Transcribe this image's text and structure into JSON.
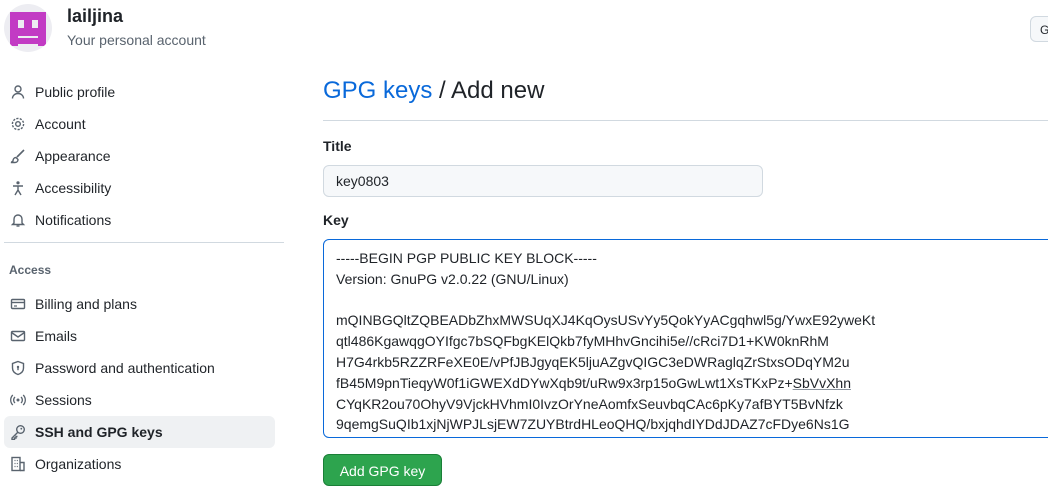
{
  "user": {
    "name": "lailjina",
    "subtitle": "Your personal account"
  },
  "corner_button": {
    "label": "G"
  },
  "nav": {
    "group1": [
      {
        "label": "Public profile",
        "icon": "person-icon"
      },
      {
        "label": "Account",
        "icon": "gear-icon"
      },
      {
        "label": "Appearance",
        "icon": "paintbrush-icon"
      },
      {
        "label": "Accessibility",
        "icon": "accessibility-icon"
      },
      {
        "label": "Notifications",
        "icon": "bell-icon"
      }
    ],
    "access_heading": "Access",
    "group2": [
      {
        "label": "Billing and plans",
        "icon": "credit-card-icon"
      },
      {
        "label": "Emails",
        "icon": "mail-icon"
      },
      {
        "label": "Password and authentication",
        "icon": "shield-lock-icon"
      },
      {
        "label": "Sessions",
        "icon": "broadcast-icon"
      },
      {
        "label": "SSH and GPG keys",
        "icon": "key-icon",
        "active": true
      },
      {
        "label": "Organizations",
        "icon": "organization-icon"
      }
    ]
  },
  "page": {
    "breadcrumb_link": "GPG keys",
    "separator": " / ",
    "heading": "Add new"
  },
  "form": {
    "title_label": "Title",
    "title_value": "key0803",
    "key_label": "Key",
    "key_lines": [
      "-----BEGIN PGP PUBLIC KEY BLOCK-----",
      "Version: GnuPG v2.0.22 (GNU/Linux)",
      "",
      "mQINBGQltZQBEADbZhxMWSUqXJ4KqOysUSvYy5QokYyACgqhwl5g/YwxE92yweKt",
      "qtl486KgawqgOYIfgc7bSQFbgKElQkb7fyMHhvGncihi5e//cRci7D1+KW0knRhM",
      "H7G4rkb5RZZRFeXE0E/vPfJBJgyqEK5ljuAZgvQIGC3eDWRaglqZrStxsODqYM2u",
      "fB45M9pnTieqyW0f1iGWEXdDYwXqb9t/uRw9x3rp15oGwLwt1XsTKxPz+",
      "CYqKR2ou70OhyV9VjckHVhmI0IvzOrYneAomfxSeuvbqCAc6pKy7afBYT5BvNfzk",
      "9qemgSuQIb1xjNjWPJLsjEW7ZUYBtrdHLeoQHQ/bxjqhdIYDdJDAZ7cFDye6Ns1G"
    ],
    "key_line7_suffix": "SbVvXhn",
    "submit_label": "Add GPG key"
  }
}
